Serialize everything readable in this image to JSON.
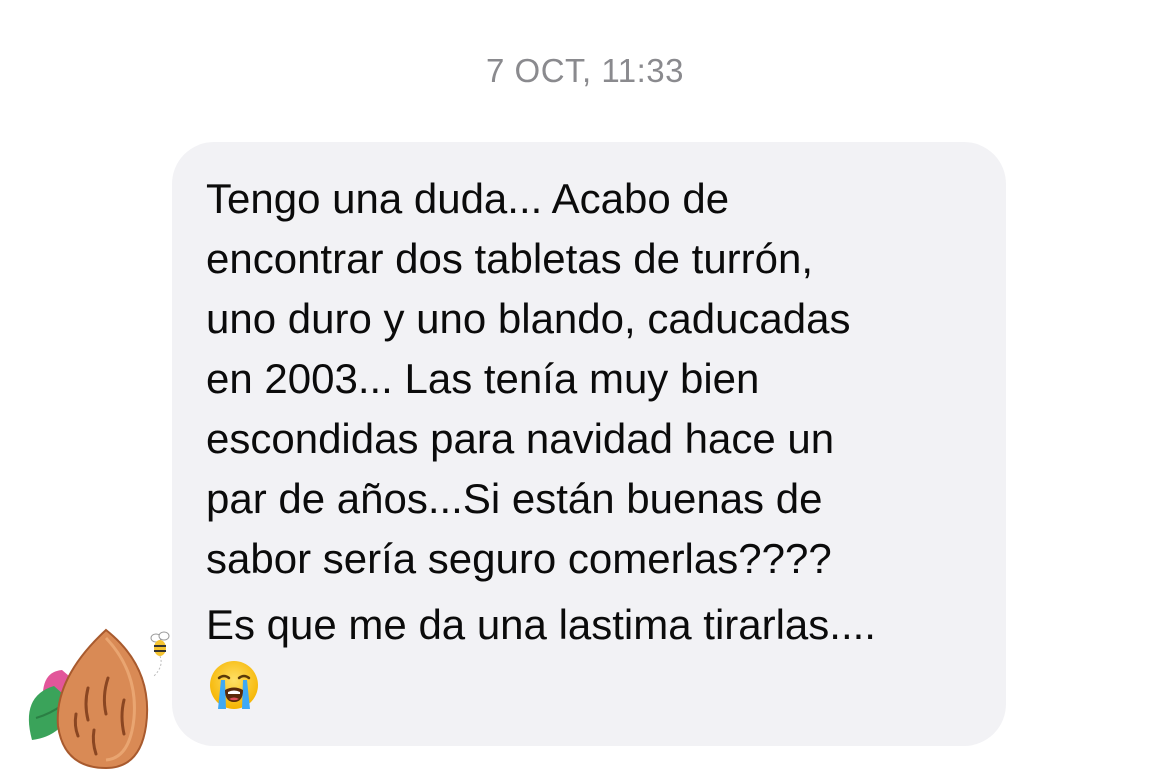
{
  "conversation": {
    "timestamp": "7 OCT, 11:33"
  },
  "message": {
    "lines": [
      "Tengo una duda... Acabo de",
      "encontrar dos tabletas de turrón,",
      "uno duro y uno blando, caducadas",
      "en 2003... Las tenía muy bien",
      "escondidas para navidad hace un",
      "par de años...Si están buenas de",
      "sabor sería seguro comerlas????",
      "Es que me da una lastima tirarlas...."
    ],
    "emoji": "loudly-crying-face-icon"
  },
  "sender": {
    "avatar_icon": "almond-bee-avatar-icon"
  },
  "colors": {
    "bubble_bg": "#f2f2f5",
    "timestamp": "#8a8a8e",
    "text": "#0b0b0b"
  }
}
